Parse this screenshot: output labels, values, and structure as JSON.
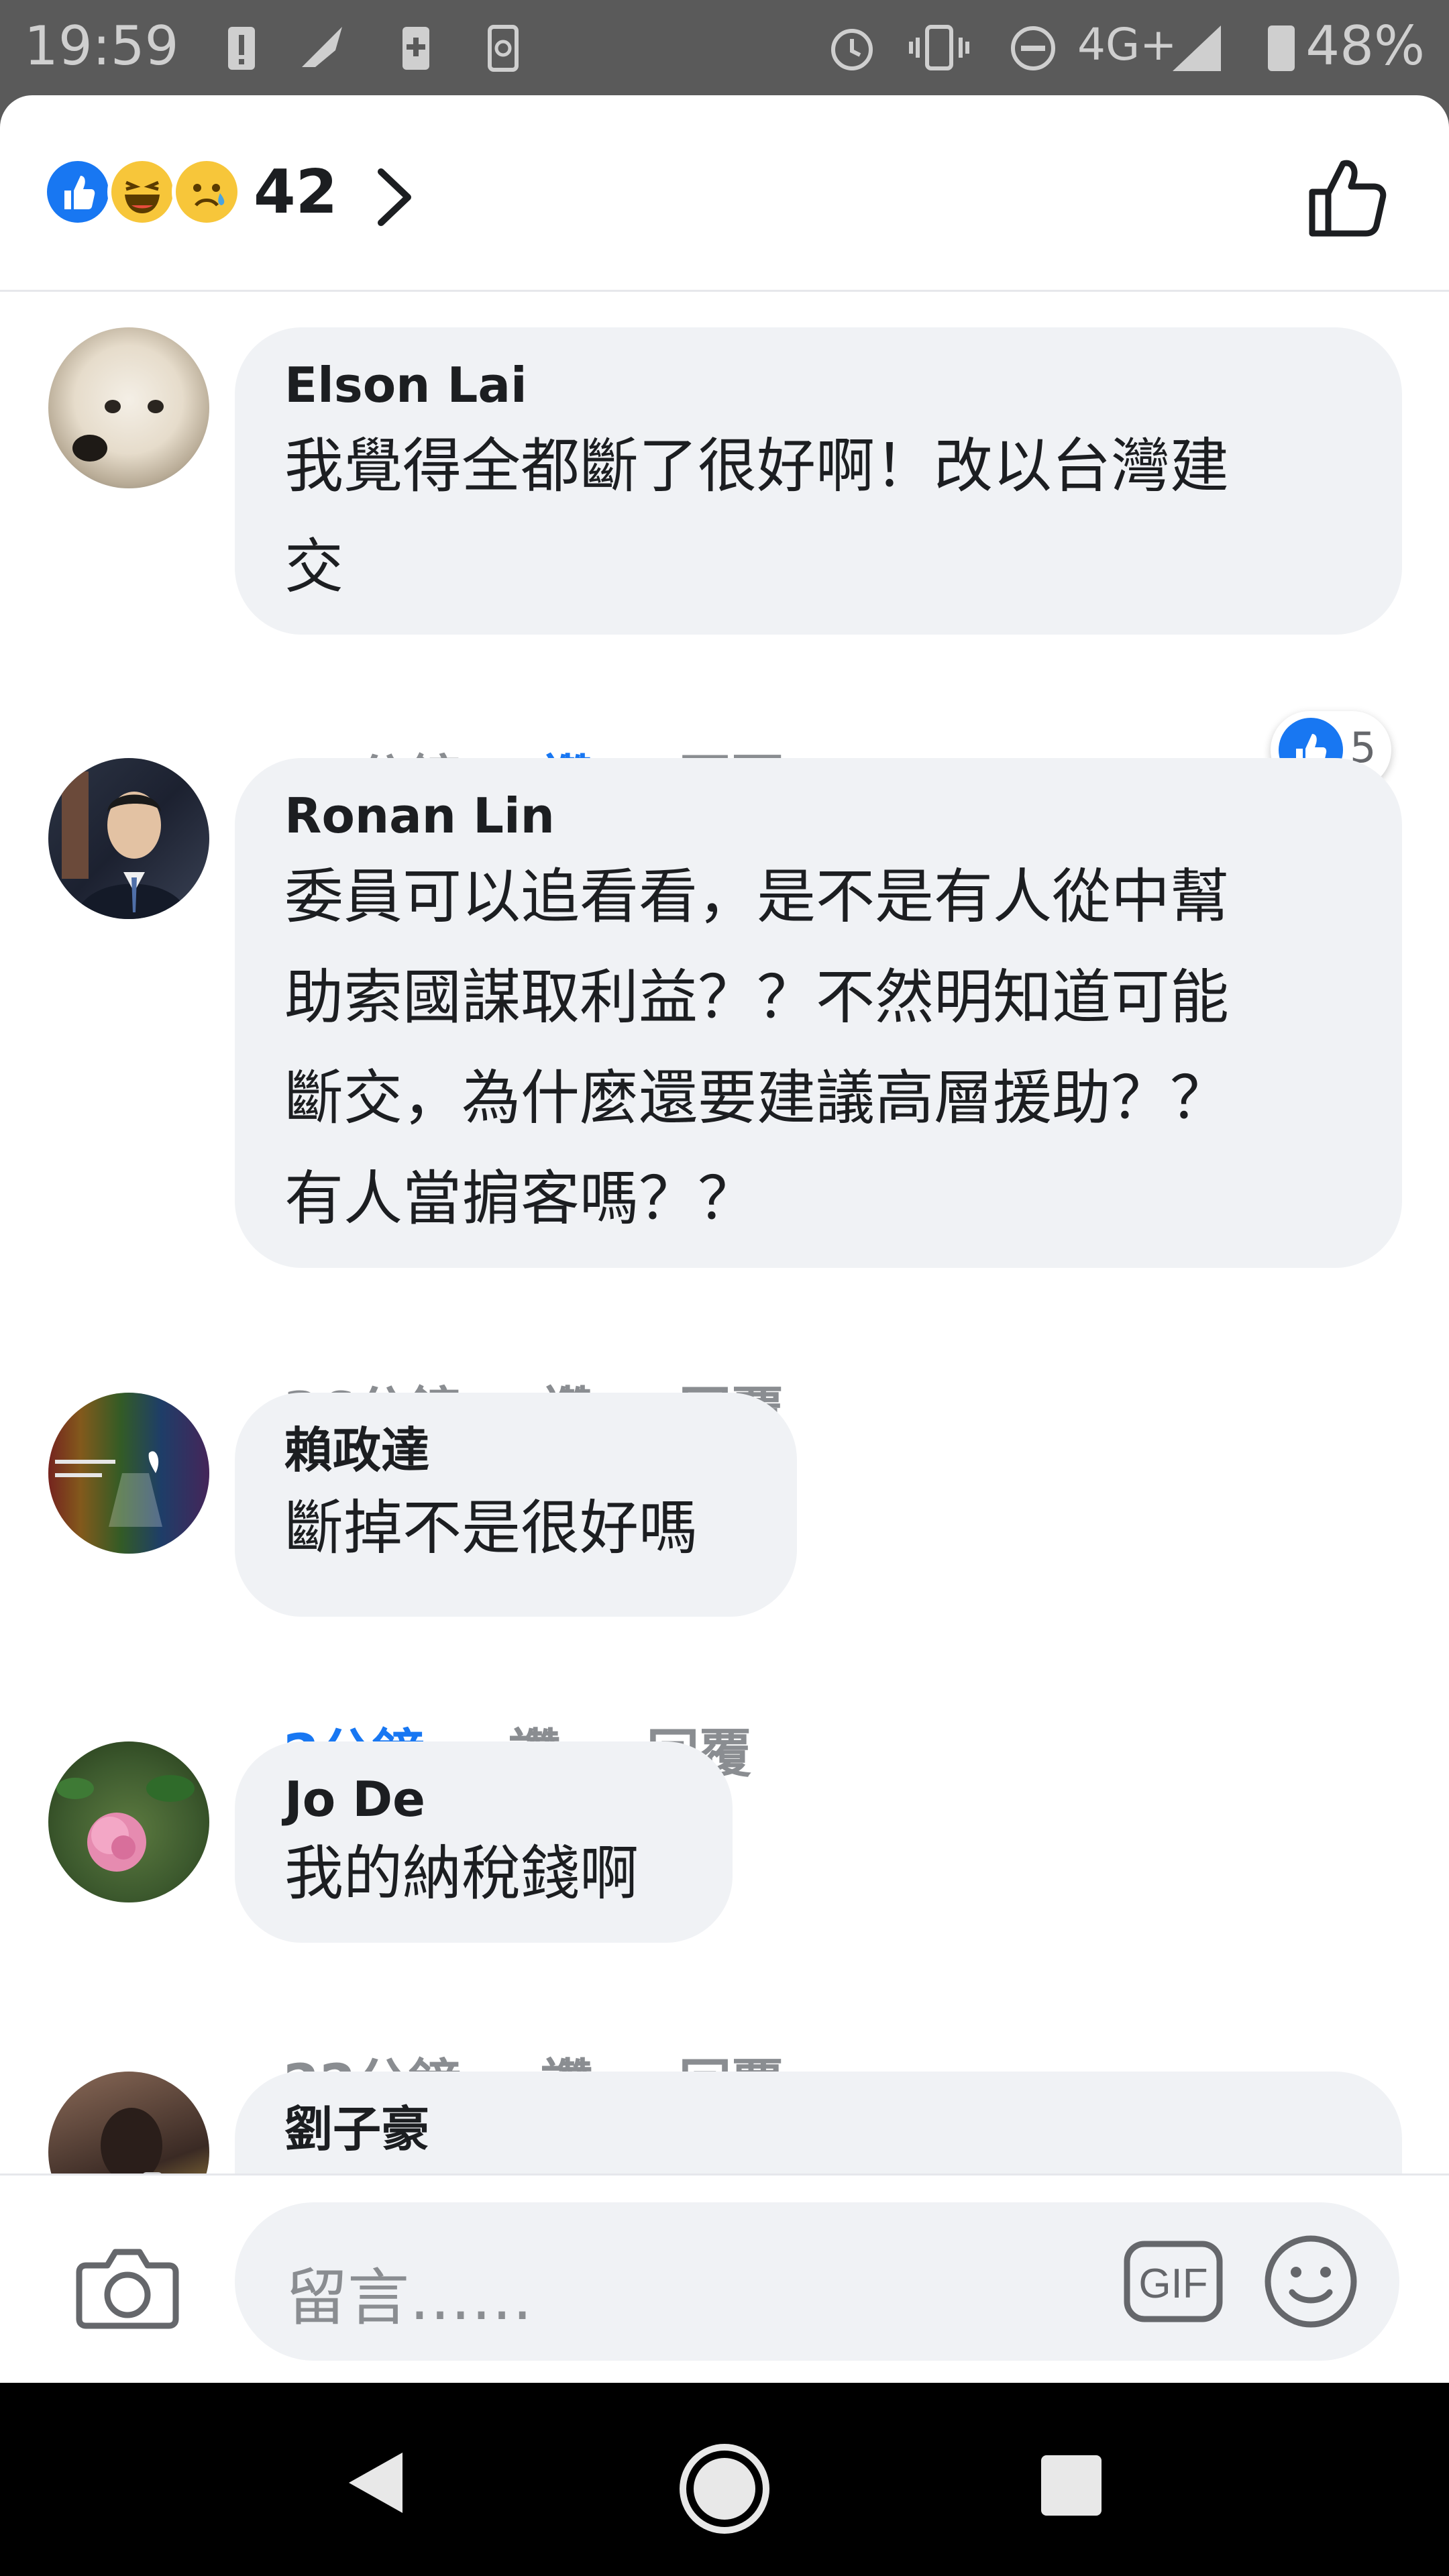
{
  "status_bar": {
    "time": "19:59",
    "network": "4G+",
    "battery": "48%"
  },
  "header": {
    "reaction_count": "42"
  },
  "comments": [
    {
      "name": "Elson Lai",
      "lines": [
        "我覺得全都斷了很好啊！改以台灣建",
        "交"
      ],
      "time": "18分鐘",
      "like": "讚",
      "reply": "回覆",
      "like_badge_count": "5",
      "liked": true
    },
    {
      "name": "Ronan Lin",
      "lines": [
        "委員可以追看看，是不是有人從中幫",
        "助索國謀取利益？？不然明知道可能",
        "斷交，為什麼還要建議高層援助？？",
        "有人當掮客嗎？？"
      ],
      "time": "36分鐘",
      "like": "讚",
      "reply": "回覆"
    },
    {
      "name": "賴政達",
      "lines": [
        "斷掉不是很好嗎"
      ],
      "time": "2分鐘",
      "like": "讚",
      "reply": "回覆",
      "time_highlight": true
    },
    {
      "name": "Jo De",
      "lines": [
        "我的納稅錢啊"
      ],
      "time": "22分鐘",
      "like": "讚",
      "reply": "回覆"
    },
    {
      "name": "劉子豪"
    }
  ],
  "composer": {
    "placeholder": "留言……",
    "gif_label": "GIF"
  },
  "colors": {
    "accent": "#1877f2",
    "bubble": "#f0f2f5",
    "muted": "#8a8d91"
  },
  "icons": [
    "like-icon",
    "haha-icon",
    "sad-icon",
    "chevron-right-icon",
    "thumbs-up-icon",
    "camera-icon",
    "gif-icon",
    "smiley-icon",
    "back-icon",
    "home-icon",
    "recent-apps-icon"
  ]
}
